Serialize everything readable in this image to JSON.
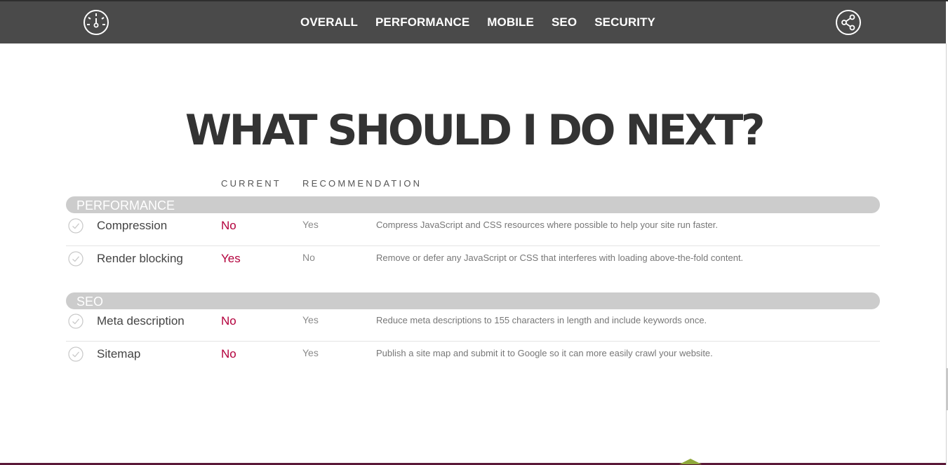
{
  "nav": {
    "items": [
      {
        "label": "OVERALL"
      },
      {
        "label": "PERFORMANCE"
      },
      {
        "label": "MOBILE"
      },
      {
        "label": "SEO"
      },
      {
        "label": "SECURITY"
      }
    ],
    "logo_icon": "speedometer-icon",
    "share_icon": "share-icon"
  },
  "main": {
    "heading": "WHAT SHOULD I DO NEXT?",
    "columns": {
      "current": "CURRENT",
      "recommendation": "RECOMMENDATION"
    },
    "sections": [
      {
        "title": "PERFORMANCE",
        "rows": [
          {
            "name": "Compression",
            "current": "No",
            "recommendation": "Yes",
            "description": "Compress JavaScript and CSS resources where possible to help your site run faster."
          },
          {
            "name": "Render blocking",
            "current": "Yes",
            "recommendation": "No",
            "description": "Remove or defer any JavaScript or CSS that interferes with loading above-the-fold content."
          }
        ]
      },
      {
        "title": "SEO",
        "rows": [
          {
            "name": "Meta description",
            "current": "No",
            "recommendation": "Yes",
            "description": "Reduce meta descriptions to 155 characters in length and include keywords once."
          },
          {
            "name": "Sitemap",
            "current": "No",
            "recommendation": "Yes",
            "description": "Publish a site map and submit it to Google so it can more easily crawl your website."
          }
        ]
      }
    ]
  },
  "colors": {
    "topbar": "#4a4a4a",
    "current_value": "#b3003c",
    "section_bar": "#cccccc"
  }
}
